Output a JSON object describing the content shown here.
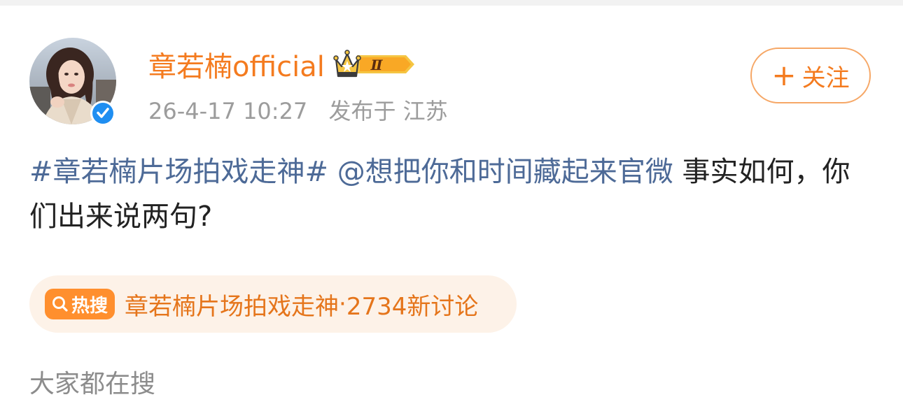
{
  "post": {
    "author": {
      "name": "章若楠official",
      "vip_level": "Ⅱ",
      "verified": true
    },
    "timestamp": "26-4-17 10:27",
    "location_prefix": "发布于",
    "location": "江苏",
    "follow_button": {
      "plus": "+",
      "label": "关注"
    },
    "content": {
      "topic": "#章若楠片场拍戏走神#",
      "mention": "@想把你和时间藏起来官微",
      "text": "事实如何，你们出来说两句?"
    },
    "hot_search": {
      "tag": "热搜",
      "title": "章若楠片场拍戏走神",
      "separator": "·",
      "count": "2734新讨论"
    }
  },
  "related": {
    "label": "大家都在搜"
  },
  "colors": {
    "brand_orange": "#f47b1f",
    "link_blue": "#4d6a97",
    "meta_gray": "#9c9c9c",
    "hot_bg": "#fdf2e8",
    "hot_tag": "#ff8f2e",
    "verified_blue": "#1f8ef1"
  },
  "icons": {
    "avatar": "avatar-photo",
    "verified": "verified-check-icon",
    "vip": "crown-vip-badge-icon",
    "hot_search": "search-magnifier-icon"
  }
}
